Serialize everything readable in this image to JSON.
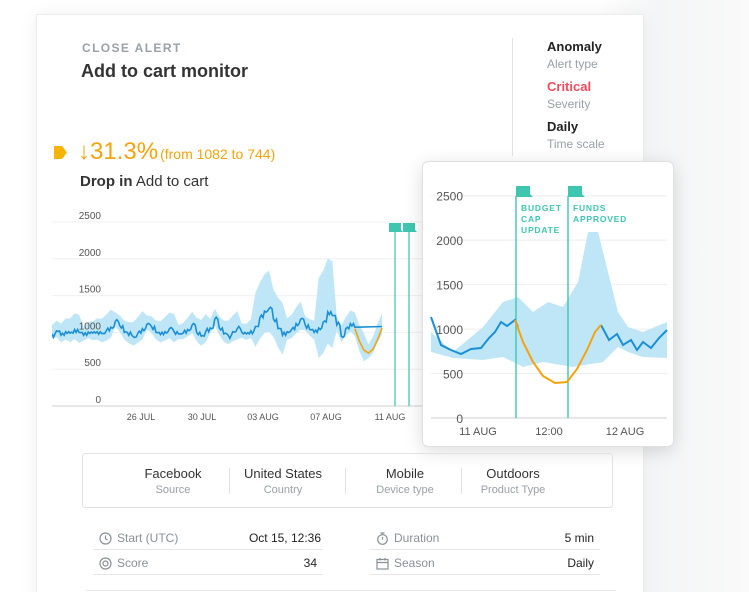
{
  "header": {
    "eyebrow": "CLOSE ALERT",
    "title": "Add to cart monitor"
  },
  "meta": [
    {
      "value": "Anomaly",
      "label": "Alert type"
    },
    {
      "value": "Critical",
      "label": "Severity"
    },
    {
      "value": "Daily",
      "label": "Time scale"
    }
  ],
  "change": {
    "arrow": "↓",
    "percent": "31.3%",
    "from_text": "(from 1082 to 744)",
    "drop_bold": "Drop in",
    "drop_metric": "Add to cart"
  },
  "chart_data": [
    {
      "type": "line",
      "series": [
        {
          "values_note": "baseline metric with expected-range band",
          "values": [
            980,
            1020,
            960,
            1010,
            990,
            1040,
            1000,
            960,
            1005,
            990,
            1010,
            985,
            1020,
            1070,
            1150,
            1090,
            1000,
            960,
            940,
            990,
            1050,
            1110,
            1080,
            1000,
            970,
            1010,
            1050,
            1010,
            980,
            990,
            1040,
            1100,
            1000,
            950,
            1010,
            1060,
            1180,
            1060,
            980,
            960,
            1010,
            1050,
            1000,
            980,
            1020,
            1080,
            1200,
            1290,
            1320,
            1180,
            1050,
            960,
            1010,
            1040,
            1120,
            1180,
            1100,
            1040,
            1000,
            1060,
            1140,
            1280,
            1230,
            1100,
            950,
            1050,
            1120,
            1070,
            880,
            750,
            720,
            800,
            960,
            1080
          ]
        }
      ],
      "y_ticks": [
        "2500",
        "2000",
        "1500",
        "1000",
        "500",
        "0"
      ],
      "x_ticks": [
        "26 JUL",
        "30 JUL",
        "03 AUG",
        "07 AUG",
        "11 AUG"
      ],
      "ylim": [
        0,
        2500
      ]
    },
    {
      "type": "line",
      "series": [
        {
          "values_note": "zoomed metric",
          "values": [
            1020,
            900,
            800,
            740,
            760,
            820,
            780,
            870,
            950,
            1050,
            1030,
            1080
          ]
        },
        {
          "values_note": "anomaly segment",
          "values": [
            1060,
            800,
            560,
            420,
            360,
            380,
            500,
            700,
            900,
            1050
          ]
        }
      ],
      "y_ticks": [
        "2500",
        "2000",
        "1500",
        "1000",
        "500",
        "0"
      ],
      "x_ticks": [
        "11 AUG",
        "12:00",
        "12 AUG"
      ],
      "events": [
        "BUDGET CAP UPDATE",
        "FUNDS APPROVED"
      ],
      "ylim": [
        0,
        2500
      ]
    }
  ],
  "dimensions": [
    {
      "value": "Facebook",
      "label": "Source"
    },
    {
      "value": "United States",
      "label": "Country"
    },
    {
      "value": "Mobile",
      "label": "Device type"
    },
    {
      "value": "Outdoors",
      "label": "Product Type"
    }
  ],
  "stats": {
    "start_label": "Start (UTC)",
    "start_value": "Oct 15, 12:36",
    "score_label": "Score",
    "score_value": "34",
    "duration_label": "Duration",
    "duration_value": "5 min",
    "season_label": "Season",
    "season_value": "Daily"
  },
  "colors": {
    "accent": "#f5a30c",
    "line": "#1a8fd6",
    "band": "#bfe6f7",
    "event": "#3ec6b0",
    "critical": "#ef4d5c"
  }
}
